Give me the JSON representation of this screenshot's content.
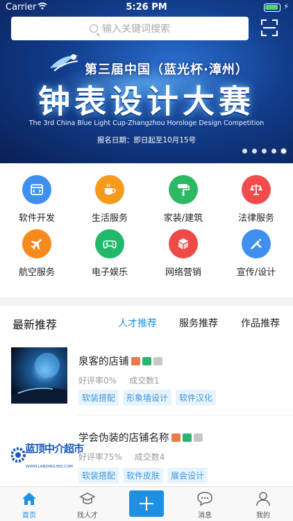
{
  "status_bar": {
    "carrier": "Carrier",
    "time": "5:26 PM"
  },
  "search": {
    "placeholder": "输入关键词搜索"
  },
  "banner": {
    "title": "第三届中国（蓝光杯·漳州）",
    "headline": "钟表设计大赛",
    "english": "The 3rd  China Blue Light  Cup-Zhangzhou Horologe Design Competition",
    "date": "报名日期：即日起至10月15号",
    "slide_count": 5,
    "active_slide": 5
  },
  "categories": [
    {
      "label": "软件开发",
      "icon": "browser-icon",
      "color": "#3f8ff0"
    },
    {
      "label": "生活服务",
      "icon": "coffee-cup-icon",
      "color": "#f59a1c"
    },
    {
      "label": "家装/建筑",
      "icon": "paint-roller-icon",
      "color": "#2db864"
    },
    {
      "label": "法律服务",
      "icon": "scales-icon",
      "color": "#f04c4c"
    },
    {
      "label": "航空服务",
      "icon": "airplane-icon",
      "color": "#f78a1d"
    },
    {
      "label": "电子娱乐",
      "icon": "gamepad-icon",
      "color": "#22b86a"
    },
    {
      "label": "网络营销",
      "icon": "cube-icon",
      "color": "#ef4a48"
    },
    {
      "label": "宣传/设计",
      "icon": "pencil-ruler-icon",
      "color": "#3f8ff0"
    }
  ],
  "recommend": {
    "title": "最新推荐",
    "tabs": [
      {
        "label": "人才推荐",
        "active": true
      },
      {
        "label": "服务推荐"
      },
      {
        "label": "作品推荐"
      }
    ],
    "items": [
      {
        "name": "泉客的店铺",
        "rating_label": "好评率0%",
        "deals_label": "成交数1",
        "tags": [
          "软装搭配",
          "形象墙设计",
          "软件汉化"
        ]
      },
      {
        "name": "学会伪装的店铺名称",
        "rating_label": "好评率75%",
        "deals_label": "成交数4",
        "tags": [
          "软装搭配",
          "软件皮肤",
          "展会设计"
        ],
        "logo_text": "蓝顶中介超市",
        "logo_url": "WWW.LANDING365.COM"
      }
    ]
  },
  "tabbar": [
    {
      "label": "首页",
      "icon": "home-icon",
      "active": true
    },
    {
      "label": "找人才",
      "icon": "graduation-cap-icon"
    },
    {
      "label": "",
      "icon": "plus-icon"
    },
    {
      "label": "消息",
      "icon": "chat-bubble-icon"
    },
    {
      "label": "我的",
      "icon": "user-icon"
    }
  ],
  "colors": {
    "accent": "#1f8fe0",
    "tag_bg": "#e8f4fd"
  }
}
